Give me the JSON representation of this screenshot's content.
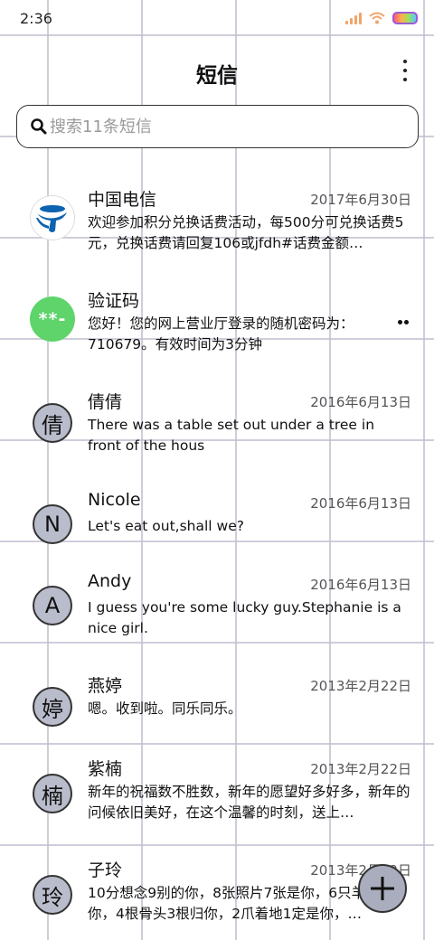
{
  "status": {
    "time": "2:36"
  },
  "header": {
    "title": "短信"
  },
  "search": {
    "placeholder": "搜索11条短信"
  },
  "messages": [
    {
      "sender": "中国电信",
      "date": "2017年6月30日",
      "snippet": "欢迎参加积分兑换话费活动，每500分可兑换话费5元，兑换话费请回复106或jfdh#话费金额…",
      "avatar_type": "telecom-logo"
    },
    {
      "sender": "验证码",
      "date": "",
      "snippet": "您好！您的网上营业厅登录的随机密码为：710679。有效时间为3分钟",
      "avatar_text": "**-",
      "unread": true
    },
    {
      "sender": "倩倩",
      "date": "2016年6月13日",
      "snippet": "There was a table set out under a tree in front of the hous",
      "avatar_text": "倩"
    },
    {
      "sender": "Nicole",
      "date": "2016年6月13日",
      "snippet": "Let's eat out,shall we?",
      "avatar_text": "N"
    },
    {
      "sender": "Andy",
      "date": "2016年6月13日",
      "snippet": "I guess you're some lucky guy.Stephanie is a nice girl.",
      "avatar_text": "A"
    },
    {
      "sender": "燕婷",
      "date": "2013年2月22日",
      "snippet": "嗯。收到啦。同乐同乐。",
      "avatar_text": "婷"
    },
    {
      "sender": "紫楠",
      "date": "2013年2月22日",
      "snippet": "新年的祝福数不胜数，新年的愿望好多好多，新年的问候依旧美好，在这个温馨的时刻，送上…",
      "avatar_text": "楠"
    },
    {
      "sender": "子玲",
      "date": "2013年2月22日",
      "snippet": "10分想念9别的你，8张照片7张是你，6只羊5只像你，4根骨头3根归你，2爪着地1定是你，…",
      "avatar_text": "玲"
    }
  ],
  "colors": {
    "avatar_bg": "#b9bccb",
    "code_avatar_bg": "#5ed46a",
    "telecom_blue": "#0d63b0",
    "fab_bg": "#a9adbd"
  },
  "icons": {
    "search": "search-icon",
    "more": "more-vert-icon",
    "compose": "plus-icon"
  }
}
